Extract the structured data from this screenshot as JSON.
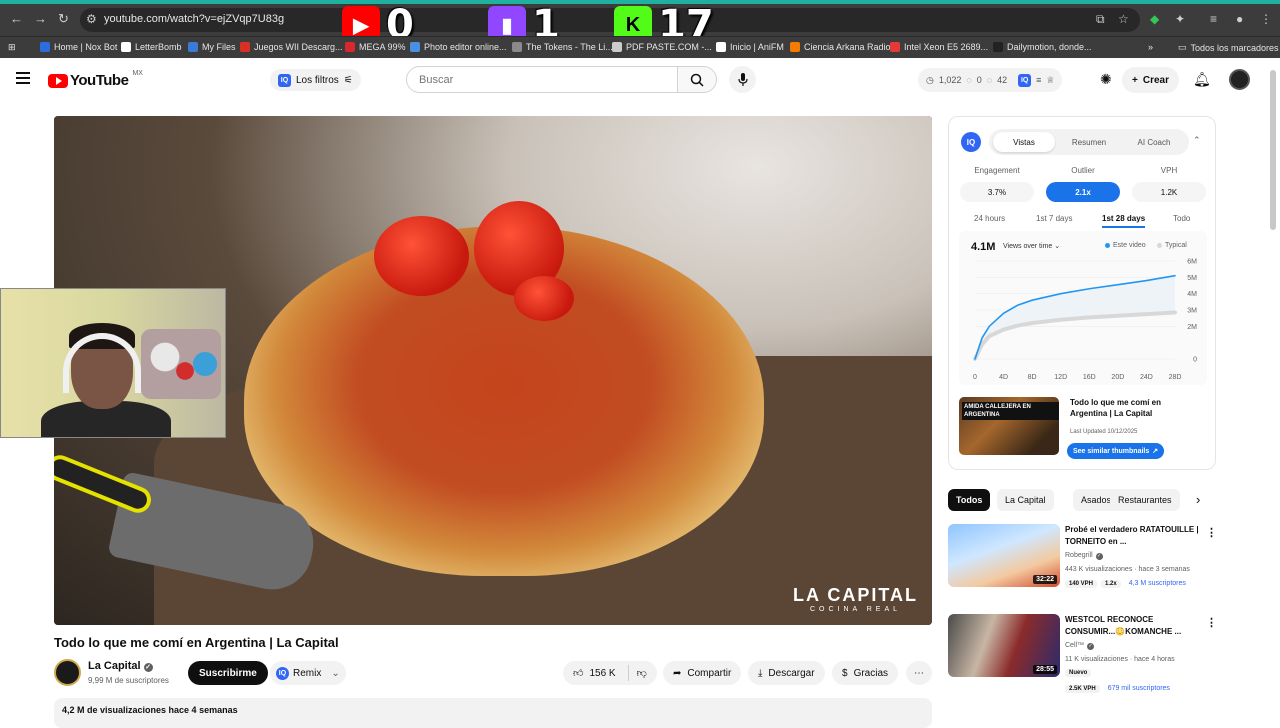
{
  "browser": {
    "url": "youtube.com/watch?v=ejZVqp7U83g",
    "overlay": [
      {
        "platform": "youtube",
        "count": "0",
        "color": "#ff0000"
      },
      {
        "platform": "twitch",
        "count": "1",
        "color": "#9146ff"
      },
      {
        "platform": "kick",
        "count": "17",
        "color": "#53fc18"
      }
    ],
    "bookmarks": [
      {
        "label": "Home | Nox Bot",
        "color": "#2d6cdf"
      },
      {
        "label": "LetterBomb",
        "color": "#ffffff"
      },
      {
        "label": "My Files",
        "color": "#3a7bd5"
      },
      {
        "label": "Juegos WII Descarg...",
        "color": "#d93025"
      },
      {
        "label": "MEGA 99%",
        "color": "#d9272e"
      },
      {
        "label": "Photo editor online...",
        "color": "#4a90e2"
      },
      {
        "label": "The Tokens - The Li...",
        "color": "#8a8a8a"
      },
      {
        "label": "PDF PASTE.COM -...",
        "color": "#cccccc"
      },
      {
        "label": "Inicio | AniFM",
        "color": "#ffffff"
      },
      {
        "label": "Ciencia Arkana Radio",
        "color": "#f57c00"
      },
      {
        "label": "Intel Xeon E5 2689...",
        "color": "#e53935"
      },
      {
        "label": "Dailymotion, donde...",
        "color": "#222222"
      }
    ],
    "all_bookmarks": "Todos los marcadores"
  },
  "header": {
    "logo_text": "YouTube",
    "country": "MX",
    "filters_label": "Los filtros",
    "search_placeholder": "Buscar",
    "stats": {
      "views": "1,022",
      "a": "0",
      "b": "42"
    },
    "create_label": "Crear"
  },
  "video": {
    "title": "Todo lo que me comí en Argentina | La Capital",
    "watermark_main": "LA CAPITAL",
    "watermark_sub": "COCINA REAL",
    "channel": "La Capital",
    "subscribers": "9,99 M de suscriptores",
    "subscribe_label": "Suscribirme",
    "remix_label": "Remix",
    "likes": "156 K",
    "share_label": "Compartir",
    "download_label": "Descargar",
    "thanks_label": "Gracias",
    "description_meta": "4,2 M de visualizaciones  hace 4 semanas"
  },
  "iq": {
    "logo": "IQ",
    "tabs": [
      "Vistas",
      "Resumen",
      "AI Coach"
    ],
    "active_tab": 0,
    "metrics": [
      {
        "label": "Engagement",
        "value": "3.7%"
      },
      {
        "label": "Outlier",
        "value": "2.1x"
      },
      {
        "label": "VPH",
        "value": "1.2K"
      }
    ],
    "active_metric": 1,
    "ranges": [
      "24 hours",
      "1st 7 days",
      "1st 28 days",
      "Todo"
    ],
    "active_range": 2,
    "chart_total": "4.1M",
    "chart_mode": "Views over time",
    "legend": [
      "Este video",
      "Typical"
    ],
    "thumb_caption": "AMIDA CALLEJERA EN ARGENTINA",
    "thumb_title": "Todo lo que me comí en Argentina | La Capital",
    "last_updated": "Last Updated 10/12/2025",
    "similar_label": "See similar thumbnails"
  },
  "chart_data": {
    "type": "area",
    "x_label_ticks": [
      "0",
      "4D",
      "8D",
      "12D",
      "16D",
      "20D",
      "24D",
      "28D"
    ],
    "y_label_ticks": [
      "0",
      "2M",
      "3M",
      "4M",
      "5M",
      "6M"
    ],
    "ylim": [
      0,
      6
    ],
    "series": [
      {
        "name": "Este video",
        "color": "#2196f3",
        "x": [
          0,
          1,
          2,
          4,
          6,
          8,
          12,
          16,
          20,
          24,
          28
        ],
        "y": [
          0,
          1.3,
          2.0,
          2.8,
          3.3,
          3.6,
          4.0,
          4.3,
          4.55,
          4.8,
          5.1
        ]
      },
      {
        "name": "Typical",
        "color": "#d8d8d8",
        "x": [
          0,
          1,
          2,
          4,
          6,
          8,
          12,
          16,
          20,
          24,
          28
        ],
        "y": [
          0,
          0.9,
          1.4,
          1.8,
          2.05,
          2.2,
          2.4,
          2.55,
          2.65,
          2.75,
          2.85
        ]
      }
    ]
  },
  "chips": [
    "Todos",
    "La Capital",
    "Asados",
    "Restaurantes"
  ],
  "recommendations": [
    {
      "title": "Probé el verdadero RATATOUILLE | TORNEITO en ...",
      "channel": "Robegrill",
      "meta": "443 K visualizaciones · hace 3 semanas",
      "duration": "32:22",
      "badges": [
        "140 VPH",
        "1.2x"
      ],
      "subs": "4,3 M suscriptores",
      "thumb_color": "#2f7ed8"
    },
    {
      "title": "WESTCOL RECONOCE CONSUMIR...😳KOMANCHE ...",
      "channel": "Cell™",
      "meta": "11 K visualizaciones · hace 4 horas",
      "duration": "28:55",
      "badges": [
        "Nuevo"
      ],
      "badges2": [
        "2.5K VPH"
      ],
      "subs": "679 mil suscriptores",
      "thumb_color": "#8b2b2b"
    }
  ]
}
